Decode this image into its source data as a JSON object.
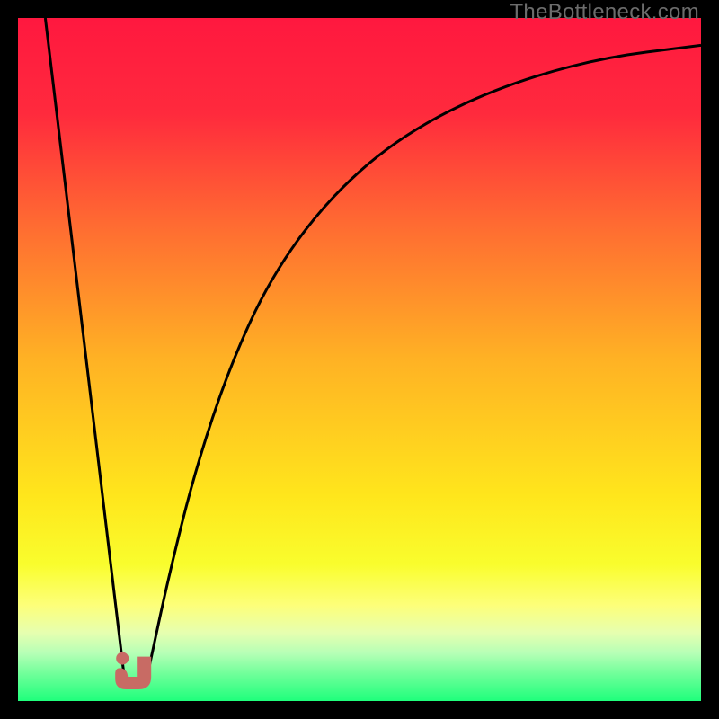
{
  "watermark": "TheBottleneck.com",
  "gradient_stops": [
    {
      "offset": 0,
      "color": "#ff183f"
    },
    {
      "offset": 0.14,
      "color": "#ff2a3d"
    },
    {
      "offset": 0.3,
      "color": "#ff6a32"
    },
    {
      "offset": 0.5,
      "color": "#ffb224"
    },
    {
      "offset": 0.7,
      "color": "#ffe61c"
    },
    {
      "offset": 0.8,
      "color": "#f9fd2d"
    },
    {
      "offset": 0.86,
      "color": "#fdff7a"
    },
    {
      "offset": 0.9,
      "color": "#e6ffb0"
    },
    {
      "offset": 0.93,
      "color": "#b6ffb6"
    },
    {
      "offset": 0.96,
      "color": "#70ff9a"
    },
    {
      "offset": 1.0,
      "color": "#1fff7c"
    }
  ],
  "chart_data": {
    "type": "line",
    "title": "",
    "xlabel": "",
    "ylabel": "",
    "xlim": [
      0,
      100
    ],
    "ylim": [
      0,
      100
    ],
    "series": [
      {
        "name": "left-segment",
        "x": [
          4,
          15.5
        ],
        "y": [
          100,
          4
        ]
      },
      {
        "name": "right-segment",
        "x": [
          19,
          22,
          26,
          31,
          37,
          45,
          55,
          68,
          84,
          100
        ],
        "y": [
          4,
          18,
          34,
          49,
          62,
          73,
          82,
          89,
          94,
          96
        ]
      }
    ],
    "annotations": [
      {
        "name": "notch-shape",
        "x_range": [
          14.5,
          19.5
        ],
        "y_range": [
          2.5,
          6.5
        ]
      }
    ]
  }
}
